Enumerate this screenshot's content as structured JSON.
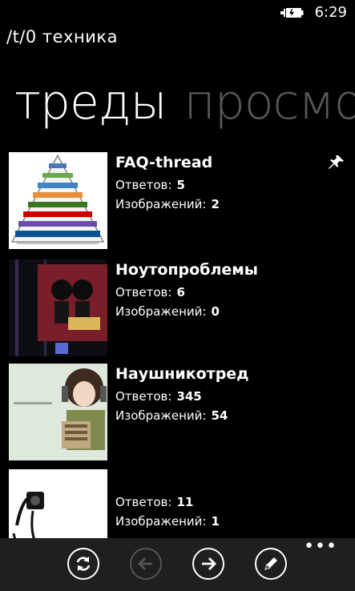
{
  "status": {
    "time": "6:29",
    "battery_icon": "battery-charging-icon"
  },
  "app": {
    "title": "/t/0 техника"
  },
  "pivot": {
    "tabs": [
      {
        "label": "треды",
        "active": true
      },
      {
        "label": "просмо",
        "active": false
      }
    ]
  },
  "threads": [
    {
      "title": "FAQ-thread",
      "replies_label": "Ответов:",
      "replies": "5",
      "images_label": "Изображений:",
      "images": "2",
      "pinned": true,
      "thumb_icon": "pyramid-diagram-image"
    },
    {
      "title": "Ноутопроблемы",
      "replies_label": "Ответов:",
      "replies": "6",
      "images_label": "Изображений:",
      "images": "0",
      "pinned": false,
      "thumb_icon": "poster-image"
    },
    {
      "title": "Наушникотред",
      "replies_label": "Ответов:",
      "replies": "345",
      "images_label": "Изображений:",
      "images": "54",
      "pinned": false,
      "thumb_icon": "anime-headphones-image"
    },
    {
      "title": "",
      "replies_label": "Ответов:",
      "replies": "11",
      "images_label": "Изображений:",
      "images": "1",
      "pinned": false,
      "thumb_icon": "headphones-image"
    }
  ],
  "appbar": {
    "buttons": [
      {
        "name": "refresh-icon",
        "enabled": true
      },
      {
        "name": "back-arrow-icon",
        "enabled": false
      },
      {
        "name": "forward-arrow-icon",
        "enabled": true
      },
      {
        "name": "edit-pencil-icon",
        "enabled": true
      }
    ],
    "more": "•••"
  }
}
